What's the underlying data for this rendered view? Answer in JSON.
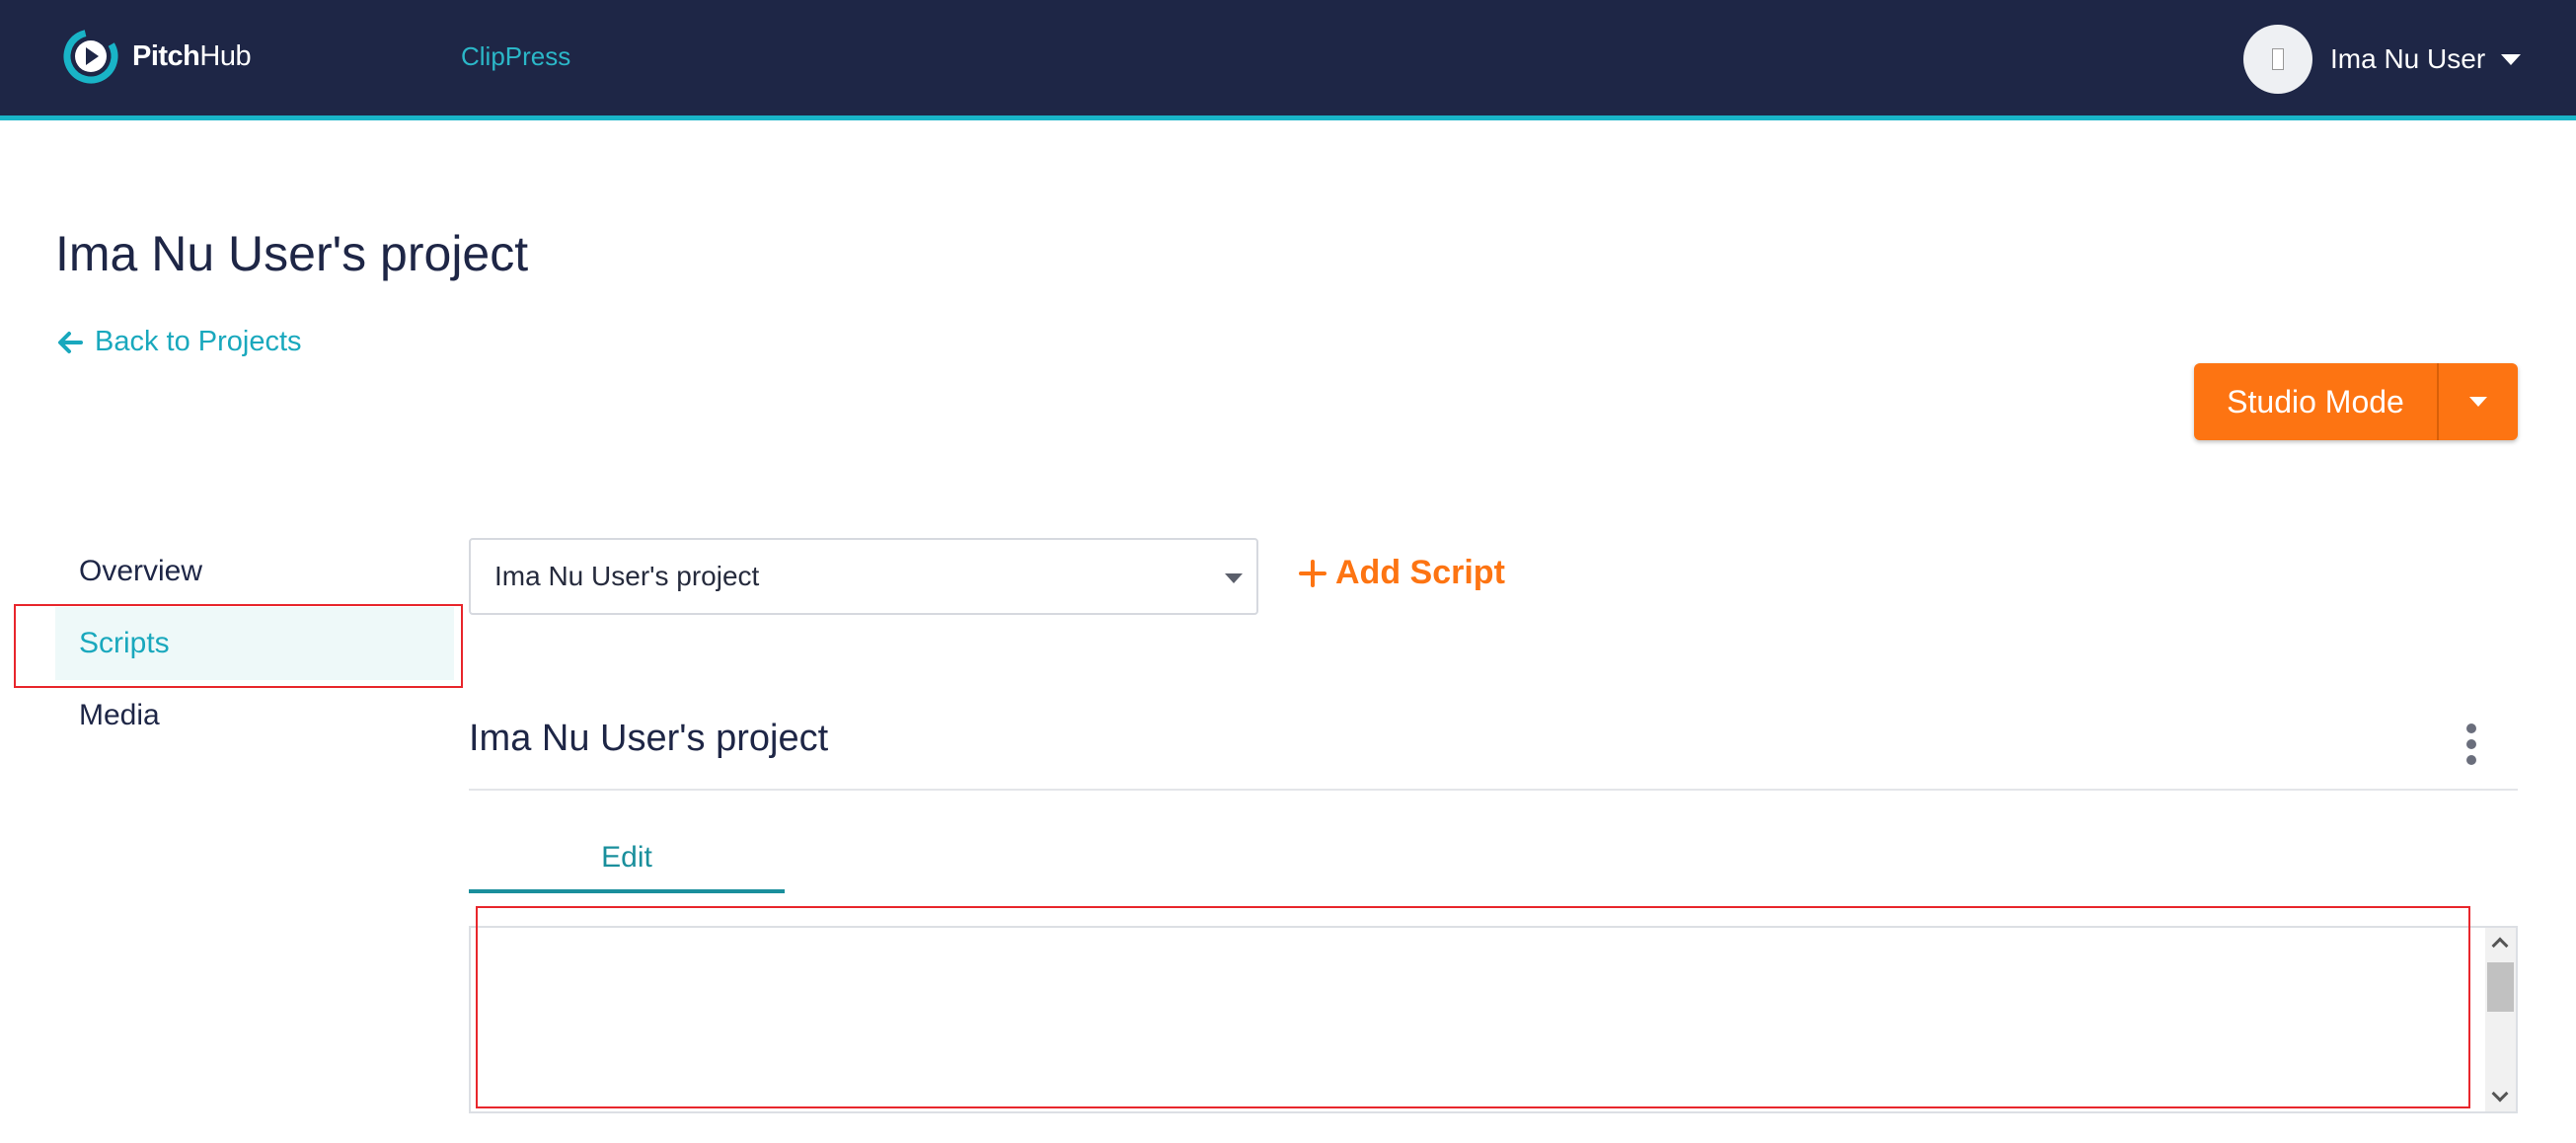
{
  "app": {
    "logo_bold": "Pitch",
    "logo_light": "Hub",
    "nav_link": "ClipPress",
    "user_name": "Ima Nu User"
  },
  "page": {
    "title": "Ima Nu User's project",
    "back_label": "Back to Projects",
    "studio_mode_label": "Studio Mode"
  },
  "sidebar": {
    "items": [
      {
        "label": "Overview",
        "active": false
      },
      {
        "label": "Scripts",
        "active": true
      },
      {
        "label": "Media",
        "active": false
      }
    ]
  },
  "main": {
    "project_select_value": "Ima Nu User's project",
    "add_script_label": "Add Script",
    "script_title": "Ima Nu User's project",
    "tabs": [
      {
        "label": "Edit",
        "active": true
      }
    ],
    "editor_text": ""
  },
  "colors": {
    "topbar": "#1e2646",
    "accent_teal": "#19a8bd",
    "accent_orange": "#fd7412",
    "highlight_red": "#e8262c"
  },
  "icons": [
    "logo-play-icon",
    "chevron-down-icon",
    "arrow-left-icon",
    "plus-icon",
    "kebab-menu-icon"
  ]
}
